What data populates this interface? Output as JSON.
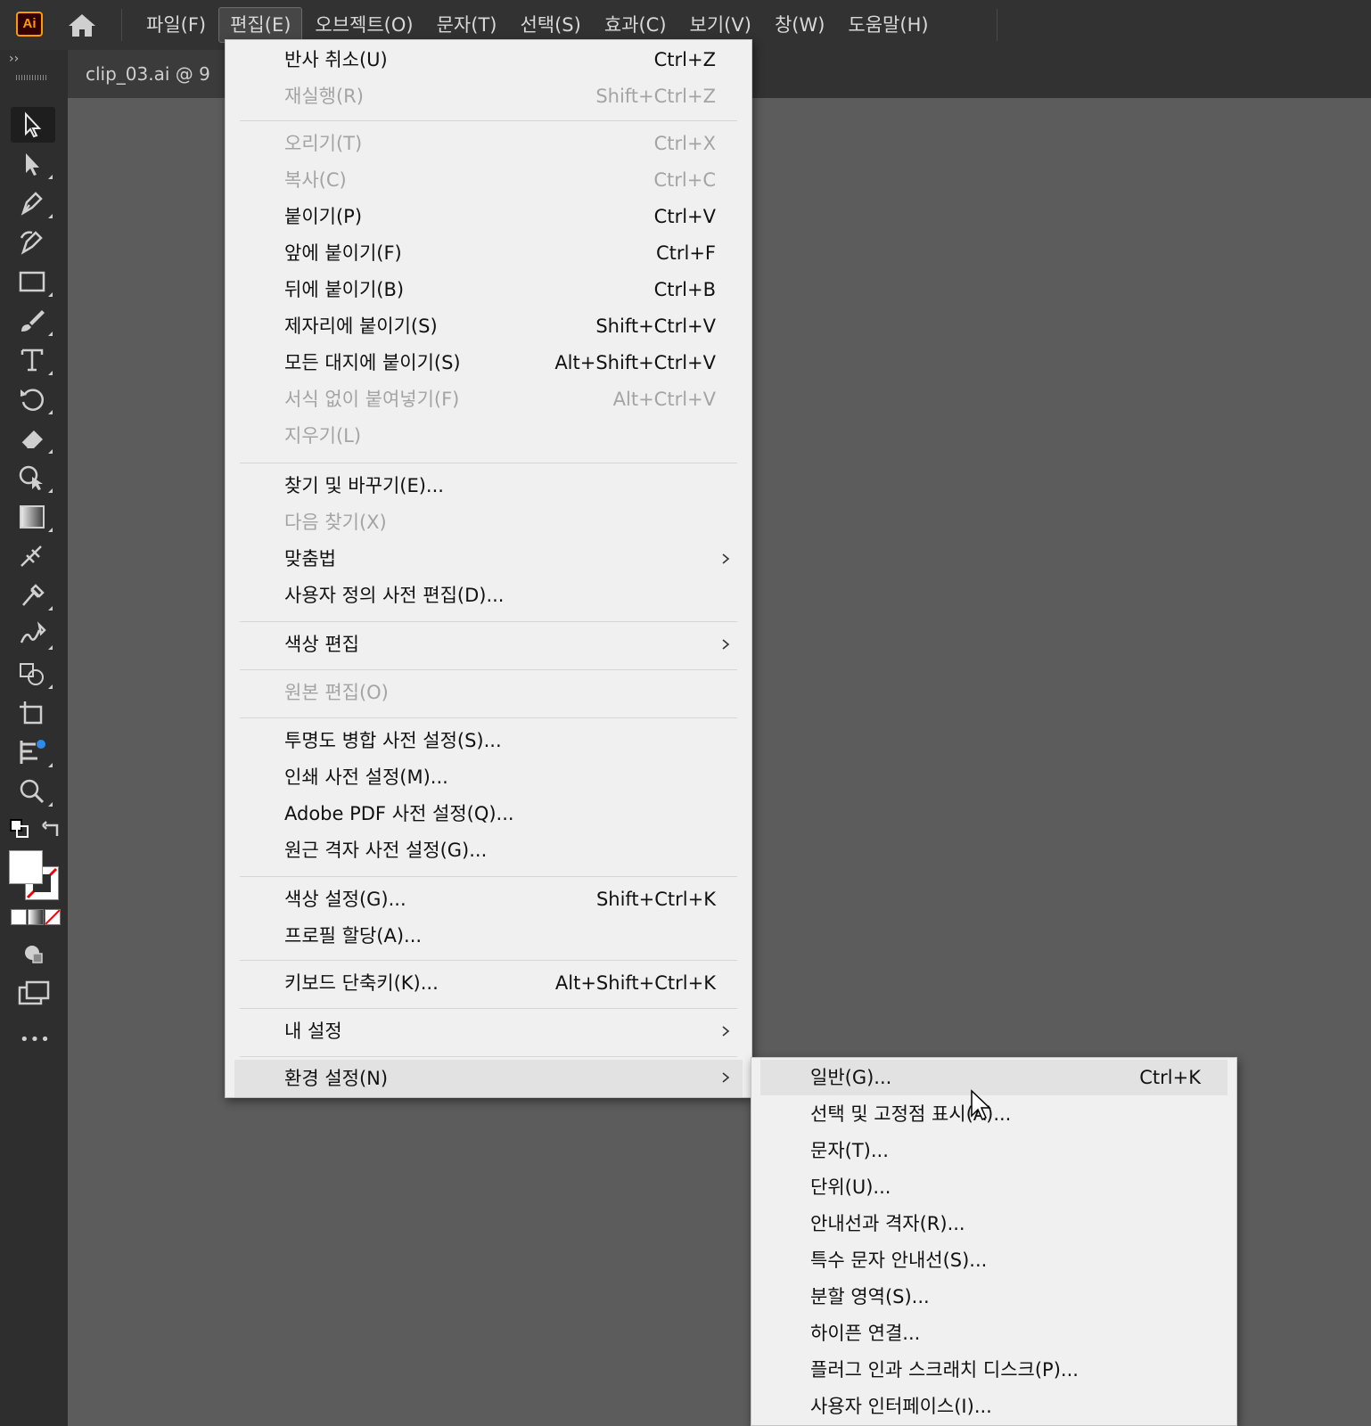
{
  "app": {
    "logo_text": "Ai",
    "menu": [
      "파일(F)",
      "편집(E)",
      "오브젝트(O)",
      "문자(T)",
      "선택(S)",
      "효과(C)",
      "보기(V)",
      "창(W)",
      "도움말(H)"
    ],
    "active_menu": "편집(E)"
  },
  "document": {
    "tab_label": "clip_03.ai  @  9"
  },
  "toolbar": {
    "collapse_label": "››",
    "tools": [
      "selection-tool",
      "direct-selection-tool",
      "pen-tool",
      "curvature-tool",
      "rectangle-tool",
      "paintbrush-tool",
      "type-tool",
      "rotate-tool",
      "eraser-tool",
      "shape-builder-tool",
      "gradient-tool",
      "width-tool",
      "eyedropper-tool",
      "blend-tool",
      "symbol-sprayer-tool",
      "artboard-tool",
      "chart-tool",
      "zoom-tool"
    ],
    "more_label": "•••"
  },
  "edit_menu": {
    "items": [
      {
        "label": "반사 취소(U)",
        "shortcut": "Ctrl+Z",
        "disabled": false
      },
      {
        "label": "재실행(R)",
        "shortcut": "Shift+Ctrl+Z",
        "disabled": true
      },
      {
        "label": "오리기(T)",
        "shortcut": "Ctrl+X",
        "disabled": true
      },
      {
        "label": "복사(C)",
        "shortcut": "Ctrl+C",
        "disabled": true
      },
      {
        "label": "붙이기(P)",
        "shortcut": "Ctrl+V",
        "disabled": false
      },
      {
        "label": "앞에 붙이기(F)",
        "shortcut": "Ctrl+F",
        "disabled": false
      },
      {
        "label": "뒤에 붙이기(B)",
        "shortcut": "Ctrl+B",
        "disabled": false
      },
      {
        "label": "제자리에 붙이기(S)",
        "shortcut": "Shift+Ctrl+V",
        "disabled": false
      },
      {
        "label": "모든 대지에 붙이기(S)",
        "shortcut": "Alt+Shift+Ctrl+V",
        "disabled": false
      },
      {
        "label": "서식 없이 붙여넣기(F)",
        "shortcut": "Alt+Ctrl+V",
        "disabled": true
      },
      {
        "label": "지우기(L)",
        "shortcut": "",
        "disabled": true
      },
      {
        "label": "찾기 및 바꾸기(E)...",
        "shortcut": "",
        "disabled": false
      },
      {
        "label": "다음 찾기(X)",
        "shortcut": "",
        "disabled": true
      },
      {
        "label": "맞춤법",
        "shortcut": "",
        "disabled": false,
        "submenu": true
      },
      {
        "label": "사용자 정의 사전 편집(D)...",
        "shortcut": "",
        "disabled": false
      },
      {
        "label": "색상 편집",
        "shortcut": "",
        "disabled": false,
        "submenu": true
      },
      {
        "label": "원본 편집(O)",
        "shortcut": "",
        "disabled": true
      },
      {
        "label": "투명도 병합 사전 설정(S)...",
        "shortcut": "",
        "disabled": false
      },
      {
        "label": "인쇄 사전 설정(M)...",
        "shortcut": "",
        "disabled": false
      },
      {
        "label": "Adobe PDF 사전 설정(Q)...",
        "shortcut": "",
        "disabled": false
      },
      {
        "label": "원근 격자 사전 설정(G)...",
        "shortcut": "",
        "disabled": false
      },
      {
        "label": "색상 설정(G)...",
        "shortcut": "Shift+Ctrl+K",
        "disabled": false
      },
      {
        "label": "프로필 할당(A)...",
        "shortcut": "",
        "disabled": false
      },
      {
        "label": "키보드 단축키(K)...",
        "shortcut": "Alt+Shift+Ctrl+K",
        "disabled": false
      },
      {
        "label": "내 설정",
        "shortcut": "",
        "disabled": false,
        "submenu": true
      },
      {
        "label": "환경 설정(N)",
        "shortcut": "",
        "disabled": false,
        "submenu": true,
        "highlighted": true
      }
    ]
  },
  "preferences_submenu": {
    "items": [
      {
        "label": "일반(G)...",
        "shortcut": "Ctrl+K",
        "highlighted": true
      },
      {
        "label": "선택 및 고정점 표시(A)...",
        "shortcut": ""
      },
      {
        "label": "문자(T)...",
        "shortcut": ""
      },
      {
        "label": "단위(U)...",
        "shortcut": ""
      },
      {
        "label": "안내선과 격자(R)...",
        "shortcut": ""
      },
      {
        "label": "특수 문자 안내선(S)...",
        "shortcut": ""
      },
      {
        "label": "분할 영역(S)...",
        "shortcut": ""
      },
      {
        "label": "하이픈 연결...",
        "shortcut": ""
      },
      {
        "label": "플러그 인과 스크래치 디스크(P)...",
        "shortcut": ""
      },
      {
        "label": "사용자 인터페이스(I)...",
        "shortcut": ""
      }
    ]
  },
  "colors": {
    "menu_bg": "#f0f0f0",
    "disabled_text": "#a4a4a4",
    "app_bg": "#323232",
    "canvas_bg": "#5c5c5c",
    "accent_orange": "#ff9a00"
  }
}
